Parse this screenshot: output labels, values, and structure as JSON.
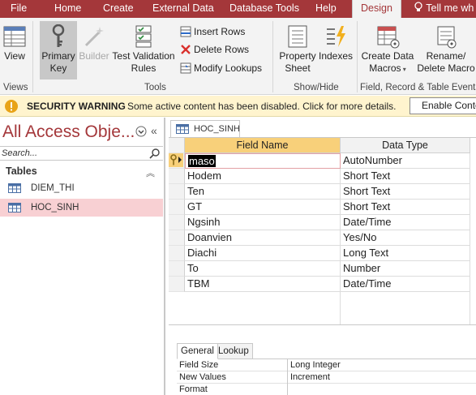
{
  "tabs": [
    "File",
    "Home",
    "Create",
    "External Data",
    "Database Tools",
    "Help",
    "Design",
    "Tell me wh"
  ],
  "ribbon": {
    "view_label": "View",
    "primary_key_label": [
      "Primary",
      "Key"
    ],
    "builder_label": "Builder",
    "test_validation_label": [
      "Test Validation",
      "Rules"
    ],
    "insert_rows": "Insert Rows",
    "delete_rows": "Delete Rows",
    "modify_lookups": "Modify Lookups",
    "property_sheet_label": [
      "Property",
      "Sheet"
    ],
    "indexes_label": "Indexes",
    "create_data_macros_label": [
      "Create Data",
      "Macros"
    ],
    "rename_delete_macro_label": [
      "Rename/",
      "Delete Macro"
    ],
    "groups": [
      "Views",
      "Tools",
      "Show/Hide",
      "Field, Record & Table Events"
    ]
  },
  "security": {
    "title": "SECURITY WARNING",
    "message": "Some active content has been disabled. Click for more details.",
    "enable_button": "Enable Conte"
  },
  "nav": {
    "title": "All Access Obje...",
    "collapse_glyph": "«",
    "search_placeholder": "Search...",
    "section": "Tables",
    "items": [
      "DIEM_THI",
      "HOC_SINH"
    ],
    "selected_index": 1
  },
  "document": {
    "tab_label": "HOC_SINH",
    "headers": [
      "Field Name",
      "Data Type"
    ],
    "rows": [
      {
        "field": "maso",
        "type": "AutoNumber"
      },
      {
        "field": "Hodem",
        "type": "Short Text"
      },
      {
        "field": "Ten",
        "type": "Short Text"
      },
      {
        "field": "GT",
        "type": "Short Text"
      },
      {
        "field": "Ngsinh",
        "type": "Date/Time"
      },
      {
        "field": "Doanvien",
        "type": "Yes/No"
      },
      {
        "field": "Diachi",
        "type": "Long Text"
      },
      {
        "field": "To",
        "type": "Number"
      },
      {
        "field": "TBM",
        "type": "Date/Time"
      }
    ]
  },
  "properties": {
    "tabs": [
      "General",
      "Lookup"
    ],
    "rows": [
      {
        "label": "Field Size",
        "value": "Long Integer"
      },
      {
        "label": "New Values",
        "value": "Increment"
      },
      {
        "label": "Format",
        "value": ""
      }
    ]
  },
  "colors": {
    "accent": "#a4373a",
    "warning_bg": "#fff4ce",
    "header_selected": "#f8d07a",
    "nav_selected": "#f8d0d3"
  }
}
